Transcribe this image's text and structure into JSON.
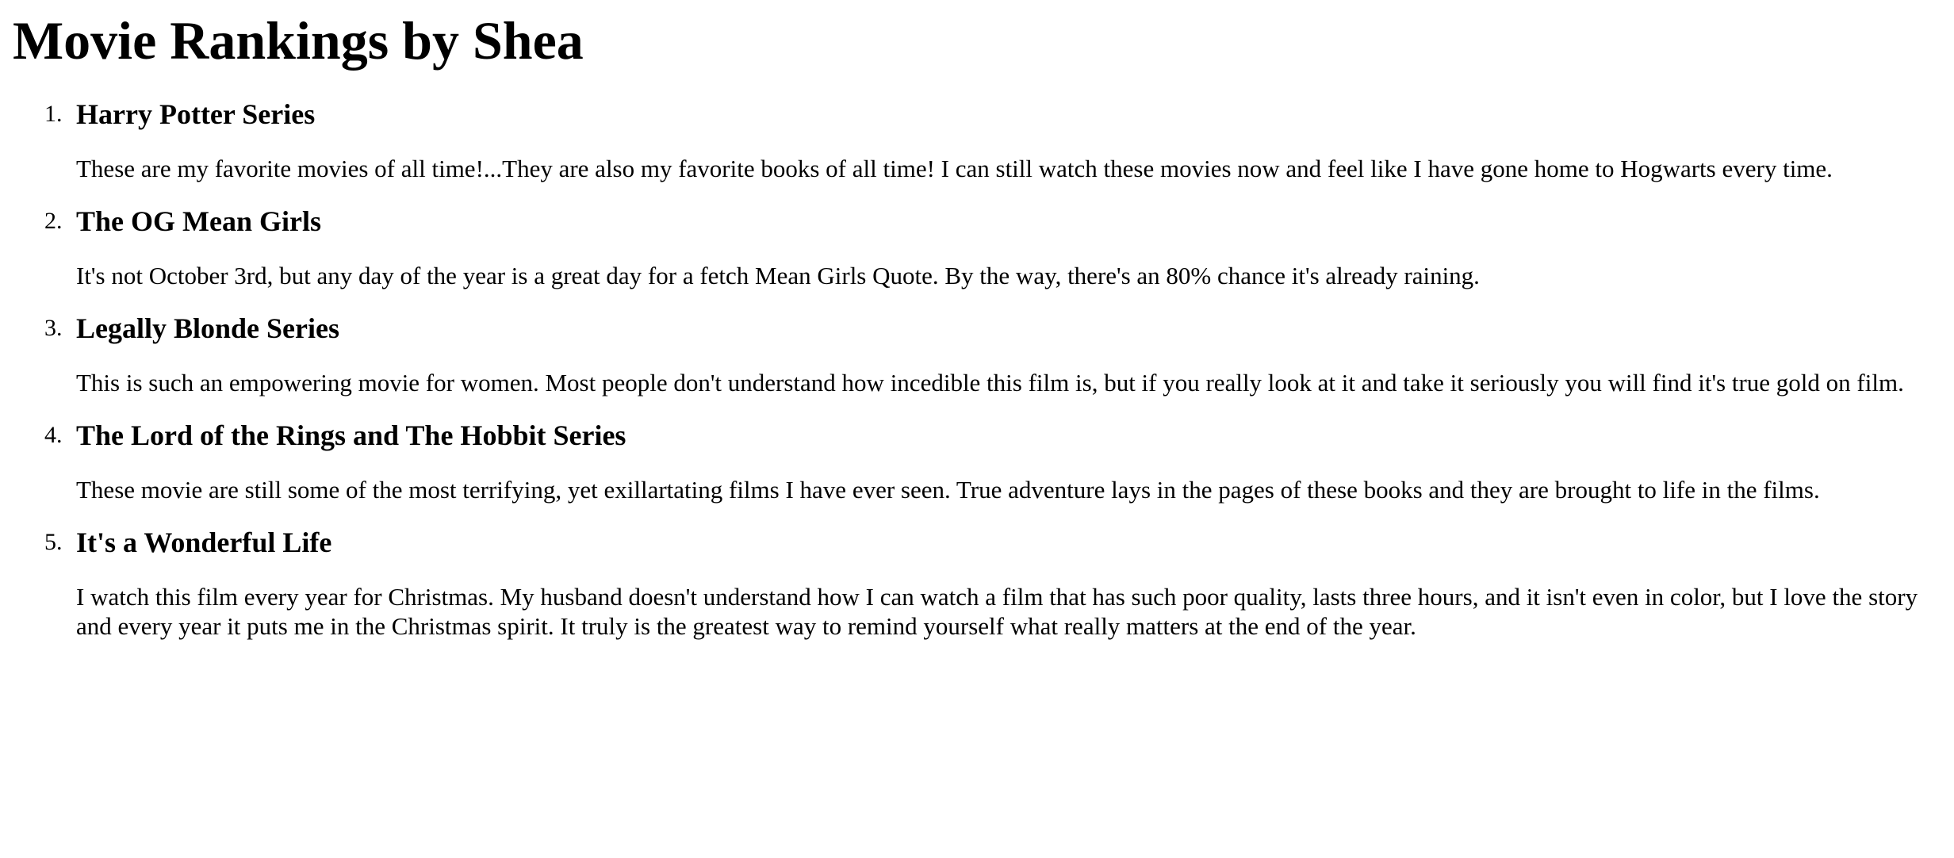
{
  "page": {
    "title": "Movie Rankings by Shea"
  },
  "movies": [
    {
      "number": "1.",
      "title": "Harry Potter Series",
      "description": "These are my favorite movies of all time!...They are also my favorite books of all time! I can still watch these movies now and feel like I have gone home to Hogwarts every time."
    },
    {
      "number": "2.",
      "title": "The OG Mean Girls",
      "description": "It's not October 3rd, but any day of the year is a great day for a fetch Mean Girls Quote. By the way, there's an 80% chance it's already raining."
    },
    {
      "number": "3.",
      "title": "Legally Blonde Series",
      "description": "This is such an empowering movie for women. Most people don't understand how incedible this film is, but if you really look at it and take it seriously you will find it's true gold on film."
    },
    {
      "number": "4.",
      "title": "The Lord of the Rings and The Hobbit Series",
      "description": "These movie are still some of the most terrifying, yet exillartating films I have ever seen. True adventure lays in the pages of these books and they are brought to life in the films."
    },
    {
      "number": "5.",
      "title": "It's a Wonderful Life",
      "description": "I watch this film every year for Christmas. My husband doesn't understand how I can watch a film that has such poor quality, lasts three hours, and it isn't even in color, but I love the story and every year it puts me in the Christmas spirit. It truly is the greatest way to remind yourself what really matters at the end of the year."
    }
  ]
}
